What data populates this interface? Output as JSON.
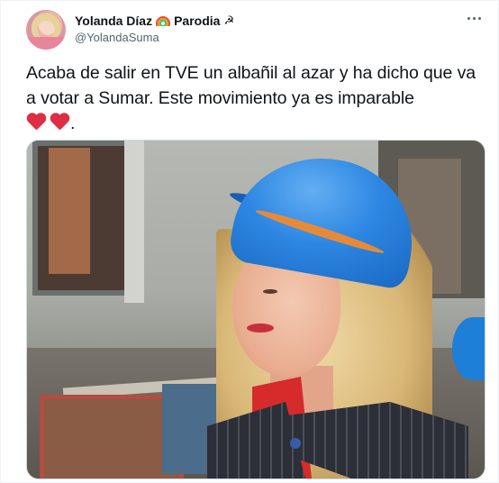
{
  "tweet": {
    "author_name": "Yolanda Díaz",
    "author_suffix": "Parodia",
    "rainbow_icon": "rainbow-flag-icon",
    "sickle_icon": "hammer-sickle-icon",
    "sickle_glyph": "☭",
    "handle": "@YolandaSuma",
    "text": "Acaba de salir en TVE un albañil al azar y ha dicho que va a votar a Sumar. Este movimiento ya es imparable",
    "trailing": ".",
    "emoji": [
      "red-heart-icon",
      "red-heart-icon"
    ],
    "more_icon": "more-options-icon",
    "heart_color": "#dd2e44",
    "name_color": "#0f1419",
    "handle_color": "#536471"
  }
}
